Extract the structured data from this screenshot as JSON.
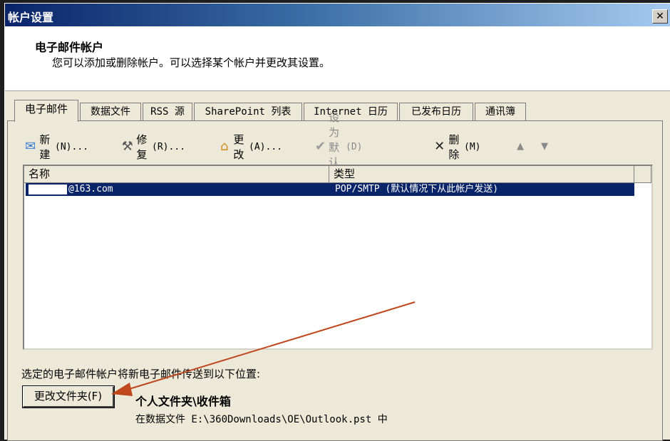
{
  "window": {
    "title": "帐户设置",
    "close_label": "✕"
  },
  "header": {
    "title": "电子邮件帐户",
    "description": "您可以添加或删除帐户。可以选择某个帐户并更改其设置。"
  },
  "tabs": [
    {
      "label": "电子邮件"
    },
    {
      "label": "数据文件"
    },
    {
      "label": "RSS 源"
    },
    {
      "label": "SharePoint 列表"
    },
    {
      "label": "Internet 日历"
    },
    {
      "label": "已发布日历"
    },
    {
      "label": "通讯簿"
    }
  ],
  "toolbar": {
    "new_label": "新建",
    "new_key": "(N)...",
    "repair_label": "修复",
    "repair_key": "(R)...",
    "change_label": "更改",
    "change_key": "(A)...",
    "set_default_label": "设为默认值",
    "set_default_key": "(D)",
    "delete_label": "删除",
    "delete_key": "(M)",
    "up_icon": "▲",
    "down_icon": "▼"
  },
  "accounts": {
    "columns": {
      "name": "名称",
      "type": "类型"
    },
    "rows": [
      {
        "name": "@163.com",
        "type": "POP/SMTP (默认情况下从此帐户发送)"
      }
    ]
  },
  "delivery": {
    "label": "选定的电子邮件帐户将新电子邮件传送到以下位置:",
    "change_folder_label": "更改文件夹(F)",
    "folder_path": "个人文件夹\\收件箱",
    "file_path": "在数据文件 E:\\360Downloads\\OE\\Outlook.pst 中"
  },
  "colors": {
    "title_bar": "#0a246a",
    "selection": "#0a246a",
    "annotation_arrow": "#c0461c"
  }
}
